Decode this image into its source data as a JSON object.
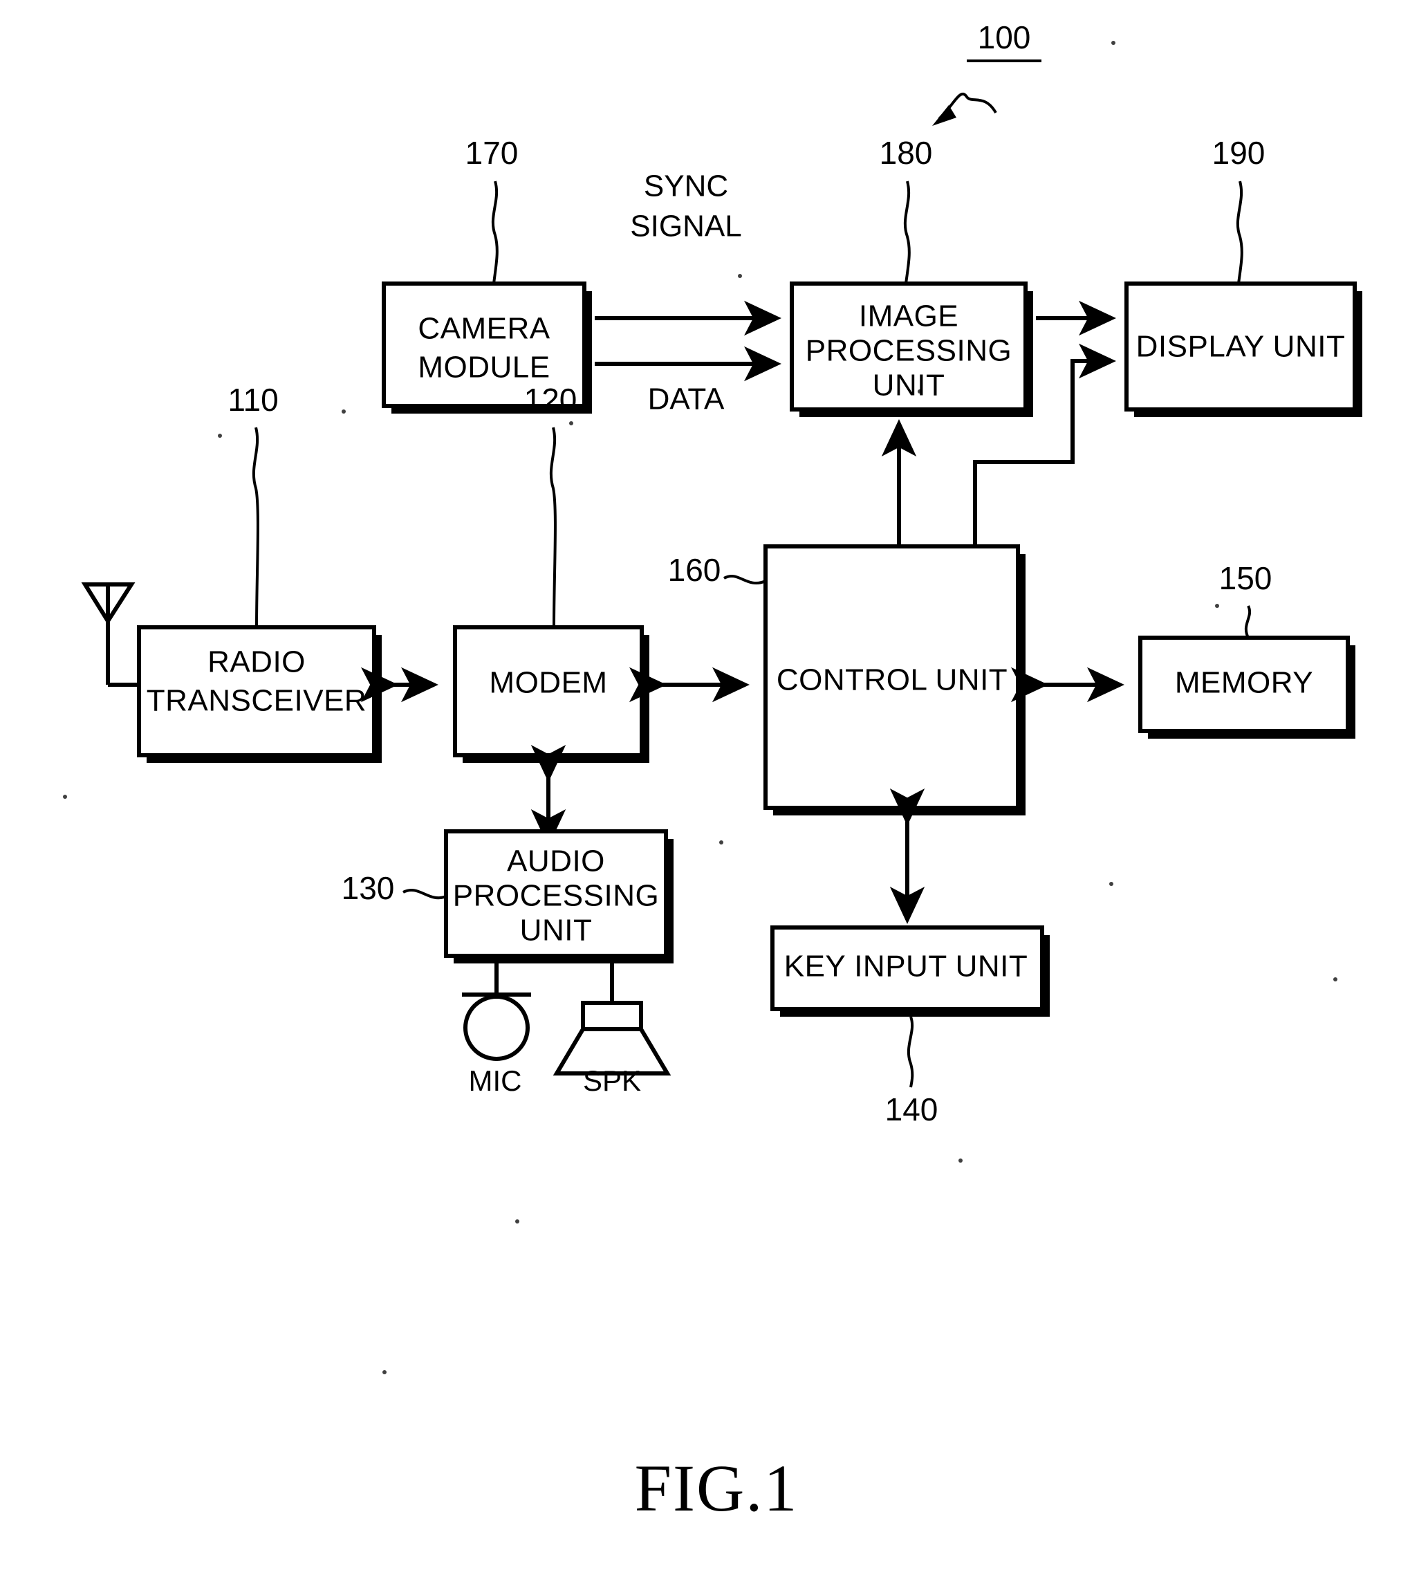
{
  "figure": {
    "caption": "FIG.1",
    "system_ref": "100"
  },
  "blocks": [
    {
      "id": "camera-module",
      "ref": "170",
      "lines": [
        "CAMERA",
        "MODULE"
      ]
    },
    {
      "id": "image-processing-unit",
      "ref": "180",
      "lines": [
        "IMAGE",
        "PROCESSING",
        "UNIT"
      ]
    },
    {
      "id": "display-unit",
      "ref": "190",
      "lines": [
        "DISPLAY UNIT"
      ]
    },
    {
      "id": "radio-transceiver",
      "ref": "110",
      "lines": [
        "RADIO",
        "TRANSCEIVER"
      ]
    },
    {
      "id": "modem",
      "ref": "120",
      "lines": [
        "MODEM"
      ]
    },
    {
      "id": "control-unit",
      "ref": "160",
      "lines": [
        "CONTROL UNIT"
      ]
    },
    {
      "id": "memory",
      "ref": "150",
      "lines": [
        "MEMORY"
      ]
    },
    {
      "id": "audio-processing-unit",
      "ref": "130",
      "lines": [
        "AUDIO",
        "PROCESSING",
        "UNIT"
      ]
    },
    {
      "id": "key-input-unit",
      "ref": "140",
      "lines": [
        "KEY INPUT UNIT"
      ]
    }
  ],
  "signal_labels": {
    "sync_line1": "SYNC",
    "sync_line2": "SIGNAL",
    "data": "DATA"
  },
  "peripherals": {
    "mic_label": "MIC",
    "spk_label": "SPK"
  },
  "colors": {
    "line": "#000000",
    "fill": "#ffffff",
    "background": "#ffffff"
  }
}
